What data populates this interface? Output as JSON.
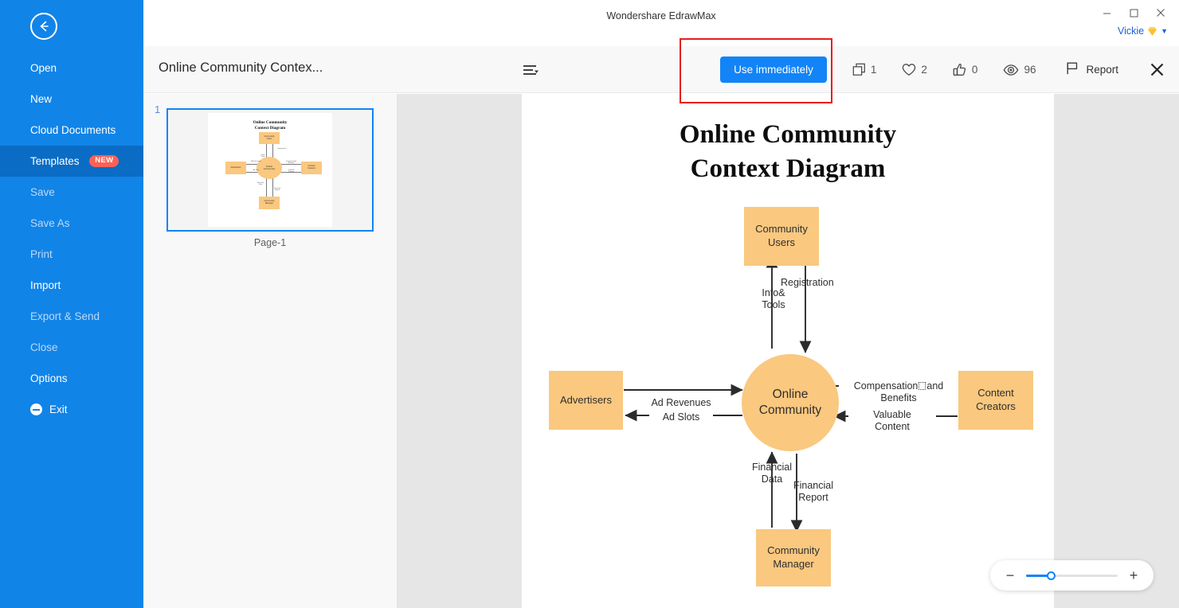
{
  "window": {
    "title": "Wondershare EdrawMax",
    "minimize_label": "–",
    "maximize_label": "□",
    "close_label": "✕"
  },
  "account": {
    "username": "Vickie",
    "badge_icon": "vip-diamond-icon",
    "caret_icon": "chevron-down-icon"
  },
  "sidebar": {
    "back_icon": "back-arrow-icon",
    "items": [
      {
        "label": "Open",
        "state": "normal"
      },
      {
        "label": "New",
        "state": "normal"
      },
      {
        "label": "Cloud Documents",
        "state": "normal"
      },
      {
        "label": "Templates",
        "state": "active",
        "badge": "NEW"
      },
      {
        "label": "Save",
        "state": "dim"
      },
      {
        "label": "Save As",
        "state": "dim"
      },
      {
        "label": "Print",
        "state": "dim"
      },
      {
        "label": "Import",
        "state": "normal"
      },
      {
        "label": "Export & Send",
        "state": "dim"
      },
      {
        "label": "Close",
        "state": "dim"
      },
      {
        "label": "Options",
        "state": "normal"
      },
      {
        "label": "Exit",
        "state": "normal",
        "icon": "minus-circle-icon"
      }
    ]
  },
  "doc_header": {
    "title": "Online Community Contex...",
    "menu_icon": "list-menu-caret-icon"
  },
  "toolbar": {
    "use_button_label": "Use immediately",
    "stats": [
      {
        "icon": "copy-icon",
        "value": "1"
      },
      {
        "icon": "heart-icon",
        "value": "2"
      },
      {
        "icon": "thumbs-up-icon",
        "value": "0"
      },
      {
        "icon": "eye-icon",
        "value": "96"
      }
    ],
    "report_label": "Report",
    "report_icon": "flag-icon",
    "close_icon": "close-icon",
    "highlight_color": "#e81d1d",
    "accent_color": "#1284f7"
  },
  "thumbnails": {
    "page_number": "1",
    "page_label": "Page-1"
  },
  "zoom_control": {
    "minus_label": "−",
    "plus_label": "+",
    "position_percent": "27"
  },
  "chart_data": {
    "type": "diagram",
    "diagram_kind": "context-diagram",
    "title": "Online Community\nContext Diagram",
    "title_line1": "Online Community",
    "title_line2": "Context Diagram",
    "node_fill": "#fac87f",
    "nodes": [
      {
        "id": "center",
        "label": "Online\nCommunity",
        "shape": "ellipse",
        "line1": "Online",
        "line2": "Community"
      },
      {
        "id": "users",
        "label": "Community\nUsers",
        "shape": "rectangle",
        "line1": "Community",
        "line2": "Users"
      },
      {
        "id": "advertisers",
        "label": "Advertisers",
        "shape": "rectangle",
        "line1": "Advertisers",
        "line2": ""
      },
      {
        "id": "creators",
        "label": "Content\nCreators",
        "shape": "rectangle",
        "line1": "Content",
        "line2": "Creators"
      },
      {
        "id": "manager",
        "label": "Community\nManager",
        "shape": "rectangle",
        "line1": "Community",
        "line2": "Manager"
      }
    ],
    "edges": [
      {
        "from": "center",
        "to": "users",
        "label": "Info&\nTools",
        "line1": "Info&",
        "line2": "Tools"
      },
      {
        "from": "users",
        "to": "center",
        "label": "Registration",
        "line1": "Registration",
        "line2": ""
      },
      {
        "from": "advertisers",
        "to": "center",
        "label": "Ad Revenues",
        "line1": "Ad Revenues",
        "line2": ""
      },
      {
        "from": "center",
        "to": "advertisers",
        "label": "Ad Slots",
        "line1": "Ad Slots",
        "line2": ""
      },
      {
        "from": "center",
        "to": "creators",
        "label": "Compensation ▧ and\nBenefits",
        "line1a": "Compensation",
        "line1b": "and",
        "line2": "Benefits"
      },
      {
        "from": "creators",
        "to": "center",
        "label": "Valuable\nContent",
        "line1": "Valuable",
        "line2": "Content"
      },
      {
        "from": "manager",
        "to": "center",
        "label": "Financial\nData",
        "line1": "Financial",
        "line2": "Data"
      },
      {
        "from": "center",
        "to": "manager",
        "label": "Financial\nReport",
        "line1": "Financial",
        "line2": "Report"
      }
    ]
  }
}
